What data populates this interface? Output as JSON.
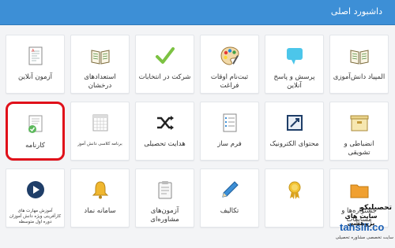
{
  "header": {
    "title": "داشبورد اصلی",
    "color": "#3d8fd6"
  },
  "tiles": [
    {
      "label": "المپیاد دانش‌آموزی",
      "icon": "open-book-icon"
    },
    {
      "label": "پرسش و پاسخ آنلاین",
      "icon": "speech-bubble-icon"
    },
    {
      "label": "ثبت‌نام اوقات فراغت",
      "icon": "palette-icon"
    },
    {
      "label": "شرکت در انتخابات",
      "icon": "checkmark-icon"
    },
    {
      "label": "استعدادهای درخشان",
      "icon": "open-book-icon"
    },
    {
      "label": "آزمون آنلاین",
      "icon": "exam-sheet-icon"
    },
    {
      "label": "انضباطی و تشویقی",
      "icon": "archive-box-icon"
    },
    {
      "label": "محتوای الکترونیک",
      "icon": "presentation-icon"
    },
    {
      "label": "فرم ساز",
      "icon": "form-list-icon"
    },
    {
      "label": "هدایت تحصیلی",
      "icon": "shuffle-arrows-icon"
    },
    {
      "label": "برنامه کلاسی دانش آموز",
      "icon": "calendar-icon"
    },
    {
      "label": "کارنامه",
      "icon": "report-card-icon"
    },
    {
      "label": "جشنواره‌ها و مسابقات",
      "icon": "award-ribbon-icon"
    },
    {
      "label": "تکالیف",
      "icon": "pencil-icon"
    },
    {
      "label": "آزمون‌های مشاوره‌ای",
      "icon": "clipboard-icon"
    },
    {
      "label": "سامانه نماد",
      "icon": "bell-icon"
    },
    {
      "label": "آموزش مهارت های کارآفرینی ویژه دانش آموزان دوره اول متوسطه",
      "icon": "video-play-icon"
    }
  ],
  "watermark": {
    "line1": "تحصیلیکو",
    "line2": "سایت های پژوهشی",
    "line3": "tahsili.co",
    "line4": "سایت تخصصی مشاوره تحصیلی"
  },
  "colors": {
    "selected_border": "#e0101a",
    "background": "#f3f4f6"
  }
}
